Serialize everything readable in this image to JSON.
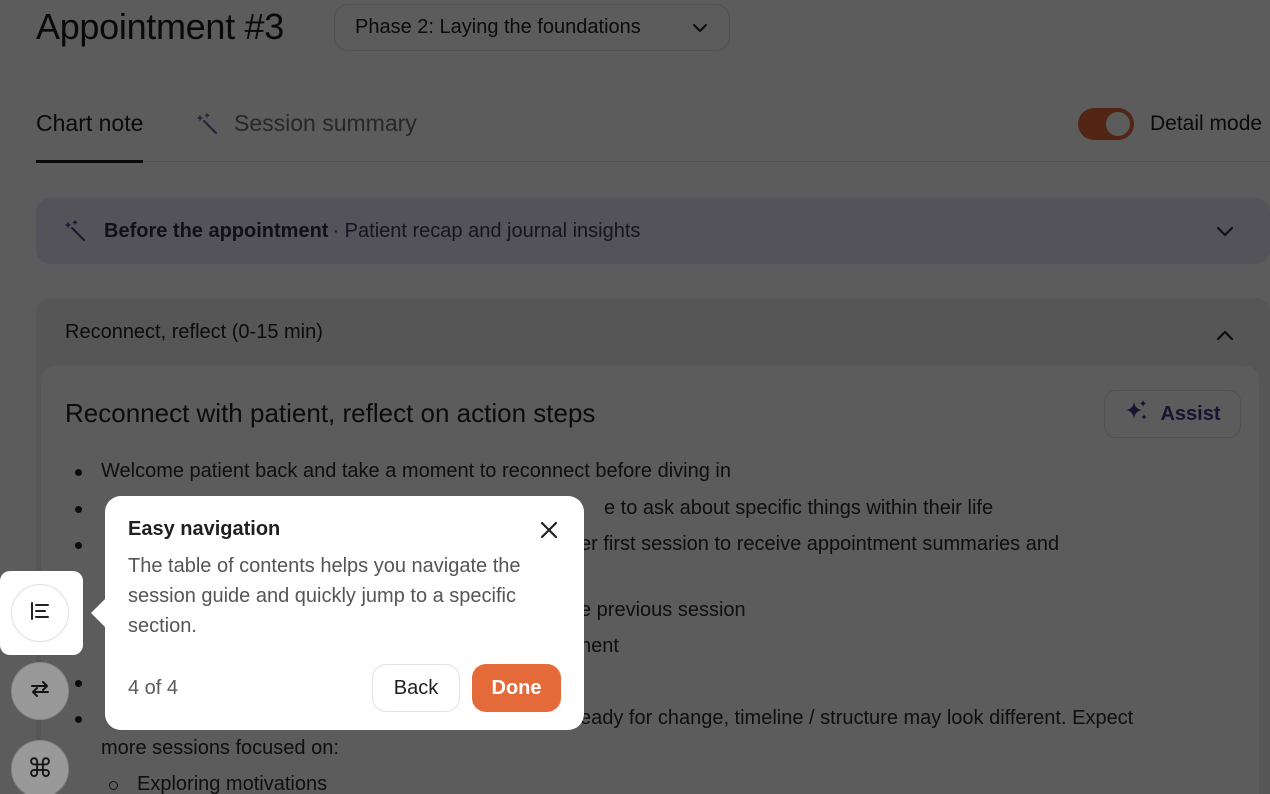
{
  "header": {
    "title": "Appointment #3",
    "phase_select": "Phase 2: Laying the foundations"
  },
  "tabs": [
    {
      "label": "Chart note",
      "active": true
    },
    {
      "label": "Session summary",
      "active": false,
      "icon": "magic-wand-icon"
    }
  ],
  "detail_mode": {
    "label": "Detail mode",
    "on": true
  },
  "before_appointment": {
    "title": "Before the appointment",
    "subtitle": "· Patient recap and journal insights"
  },
  "section": {
    "header": "Reconnect, reflect (0-15 min)",
    "card_title": "Reconnect with patient, reflect on action steps",
    "assist_label": "Assist",
    "bullets": [
      "Welcome patient back and take a moment to reconnect before diving in",
      "e to ask about specific things within their life",
      "er first session to receive appointment summaries and",
      "e previous session",
      "nent",
      "eady for change, timeline / structure may look different. Expect",
      "more sessions focused on:"
    ],
    "sub_bullets": [
      "Exploring motivations"
    ]
  },
  "tour": {
    "title": "Easy navigation",
    "body": "The table of contents helps you navigate the session guide and quickly jump to a specific section.",
    "step": "4 of 4",
    "back_label": "Back",
    "done_label": "Done"
  },
  "colors": {
    "accent": "#e46a3a",
    "banner_bg": "#ebe8f8",
    "assist_text": "#3b3a8a"
  }
}
